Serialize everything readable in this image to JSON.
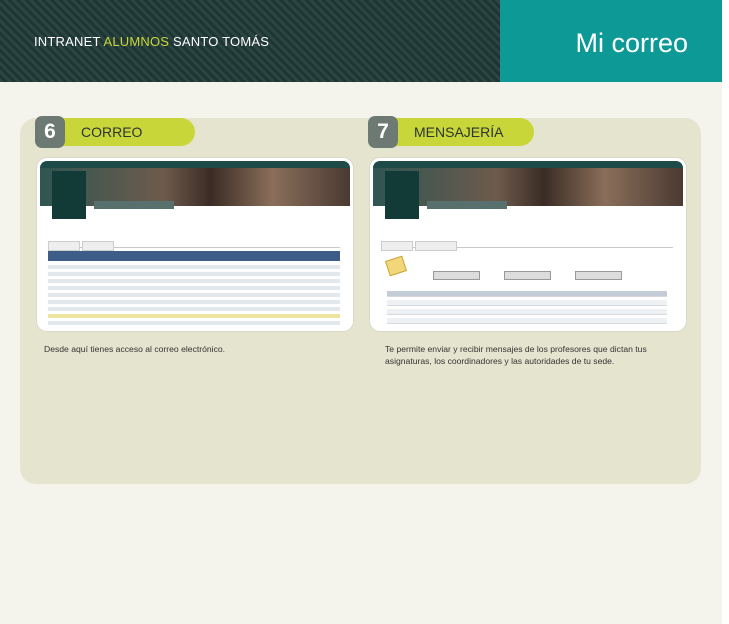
{
  "header": {
    "prefix": "INTRANET",
    "accent": "ALUMNOS",
    "suffix": "SANTO TOMÁS",
    "page_title": "Mi correo"
  },
  "sections": [
    {
      "number": "6",
      "title": "CORREO",
      "description": "Desde aquí tienes acceso al correo electrónico."
    },
    {
      "number": "7",
      "title": "MENSAJERÍA",
      "description_line1": "Te permite enviar y recibir mensajes de los profesores que dictan tus",
      "description_line2": "asignaturas, los coordinadores y las autoridades de tu sede."
    }
  ],
  "colors": {
    "header_dark": "#2a4542",
    "header_teal": "#0d9a97",
    "accent": "#c8d63a",
    "panel": "#e5e4ce",
    "badge": "#6d7a74"
  }
}
